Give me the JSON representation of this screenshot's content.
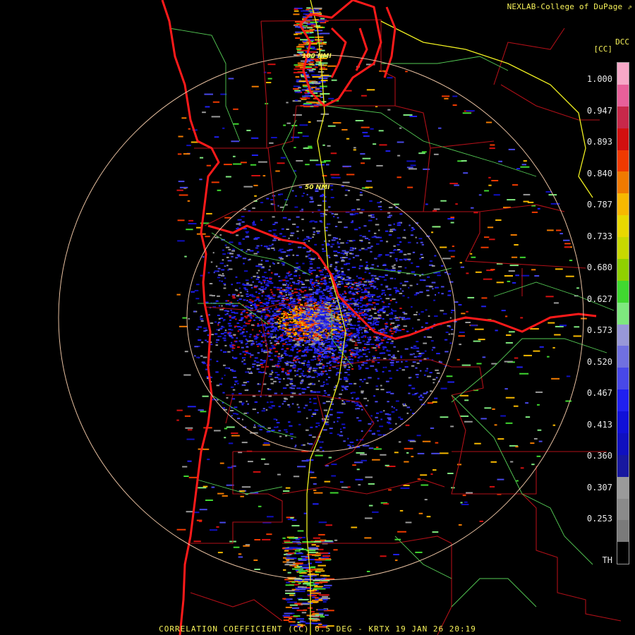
{
  "credit": "NEXLAB-College of DuPage",
  "credit_icon": "external-link-icon",
  "product_code": "DCC",
  "unit": "[CC]",
  "footer": "CORRELATION COEFFICIENT (CC) 0.5 DEG - KRTX 19 JAN 26 20:19",
  "range_rings": [
    {
      "label": "100 NMI",
      "range_nmi": 100
    },
    {
      "label": "50 NMI",
      "range_nmi": 50
    }
  ],
  "legend": {
    "ticks": [
      "1.000",
      "0.947",
      "0.893",
      "0.840",
      "0.787",
      "0.733",
      "0.680",
      "0.627",
      "0.573",
      "0.520",
      "0.467",
      "0.413",
      "0.360",
      "0.307",
      "0.253",
      "TH"
    ],
    "colors": [
      "#f7a8c8",
      "#e8609a",
      "#c8284a",
      "#d21010",
      "#f03a00",
      "#f07a00",
      "#f7b800",
      "#e8d800",
      "#c8d800",
      "#90d000",
      "#40d830",
      "#7ee87e",
      "#9898d8",
      "#7070e0",
      "#4848e8",
      "#2020f0",
      "#1010d8",
      "#1010c0",
      "#1818a0",
      "#9a9a9a",
      "#8a8a8a",
      "#7a7a7a",
      "#000000"
    ],
    "stops": [
      0,
      0.03,
      0.06,
      0.09,
      0.12,
      0.15,
      0.18,
      0.21,
      0.24,
      0.27,
      0.3,
      0.33,
      0.36,
      0.4,
      0.44,
      0.5,
      0.56,
      0.62,
      0.7,
      0.72,
      0.82,
      0.9,
      0.98
    ]
  },
  "colors": {
    "text_yellow": "#f7f25a",
    "ring": "#e8c0a0",
    "county": "#d0121c",
    "coast": "#ff1a1a",
    "highway": "#66dd66",
    "interstate": "#f0f020"
  }
}
